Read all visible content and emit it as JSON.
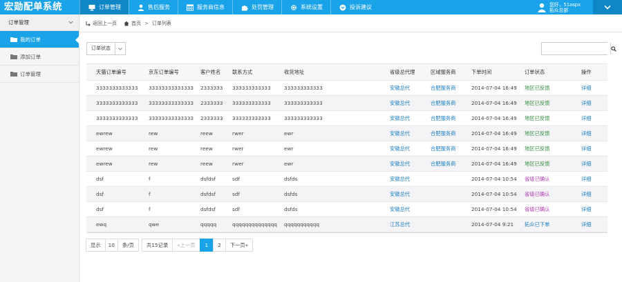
{
  "brand": "宏勋配单系统",
  "nav": [
    {
      "label": "订单管理",
      "icon": "monitor-icon"
    },
    {
      "label": "售后服务",
      "icon": "person-icon"
    },
    {
      "label": "服务商信息",
      "icon": "grid-icon"
    },
    {
      "label": "处罚管理",
      "icon": "puzzle-icon"
    },
    {
      "label": "系统设置",
      "icon": "gear-icon"
    },
    {
      "label": "投诉建议",
      "icon": "chevron-circle-icon"
    }
  ],
  "user": {
    "greeting": "您好，51aspx",
    "role": "拓众总部"
  },
  "sidebar": {
    "header": "订单管理",
    "items": [
      {
        "label": "我的订单"
      },
      {
        "label": "添加订单"
      },
      {
        "label": "订单管理"
      }
    ]
  },
  "breadcrumb": {
    "back": "返回上一页",
    "home": "首页",
    "current": "订单列表"
  },
  "filter": {
    "label": "订单状态"
  },
  "search": {
    "placeholder": ""
  },
  "table": {
    "headers": [
      "天猫订单编号",
      "京东订单编号",
      "客户姓名",
      "联系方式",
      "收货地址",
      "省级总代理",
      "区域服务商",
      "下单时间",
      "订单状态",
      "操作"
    ],
    "rows": [
      [
        "3333333333333",
        "33333333333333",
        "2333333",
        "333333333333",
        "333333333333",
        "安徽总代",
        "合肥服务商",
        "2014-07-04 16:49",
        "地区已反馈",
        "详细"
      ],
      [
        "3333333333333",
        "33333333333333",
        "2333333",
        "333333333333",
        "333333333333",
        "安徽总代",
        "合肥服务商",
        "2014-07-04 16:49",
        "地区已反馈",
        "详细"
      ],
      [
        "3333333333333",
        "33333333333333",
        "2333333",
        "333333333333",
        "333333333333",
        "安徽总代",
        "合肥服务商",
        "2014-07-04 16:49",
        "地区已反馈",
        "详细"
      ],
      [
        "ewrew",
        "rew",
        "reew",
        "rwer",
        "ewr",
        "安徽总代",
        "合肥服务商",
        "2014-07-04 16:49",
        "地区已反馈",
        "详细"
      ],
      [
        "ewrew",
        "rew",
        "reew",
        "rwer",
        "ewr",
        "安徽总代",
        "合肥服务商",
        "2014-07-04 16:49",
        "地区已反馈",
        "详细"
      ],
      [
        "ewrew",
        "rew",
        "reew",
        "rwer",
        "ewr",
        "安徽总代",
        "合肥服务商",
        "2014-07-04 16:49",
        "地区已反馈",
        "详细"
      ],
      [
        "dsf",
        "f",
        "dsfdsf",
        "sdf",
        "dsfds",
        "安徽总代",
        "",
        "2014-07-04 10:54",
        "省级已确认",
        "详细"
      ],
      [
        "dsf",
        "f",
        "dsfdsf",
        "sdf",
        "dsfds",
        "安徽总代",
        "",
        "2014-07-04 10:54",
        "省级已确认",
        "详细"
      ],
      [
        "dsf",
        "f",
        "dsfdsf",
        "sdf",
        "dsfds",
        "安徽总代",
        "",
        "2014-07-04 10:54",
        "省级已确认",
        "详细"
      ],
      [
        "ewq",
        "qwe",
        "qqqqq",
        "qqqqqqqqqqqqqq",
        "qqqqqqqqqqq",
        "江苏总代",
        "",
        "2014-07-04 9:21",
        "拓众已下单",
        "详细"
      ]
    ],
    "status_colors": {
      "地区已反馈": "#2e8b3a",
      "省级已确认": "#b03cb0",
      "拓众已下单": "#1c7fc5"
    }
  },
  "pager": {
    "show_label": "显示",
    "page_size": "10",
    "per_page_label": "条/页",
    "total": "共15记录",
    "prev": "«上一页",
    "pages": [
      "1",
      "2"
    ],
    "next": "下一页»"
  },
  "colors": {
    "accent": "#1aa3e8",
    "accent_dark": "#0f86c6",
    "link": "#1c7fc5"
  }
}
